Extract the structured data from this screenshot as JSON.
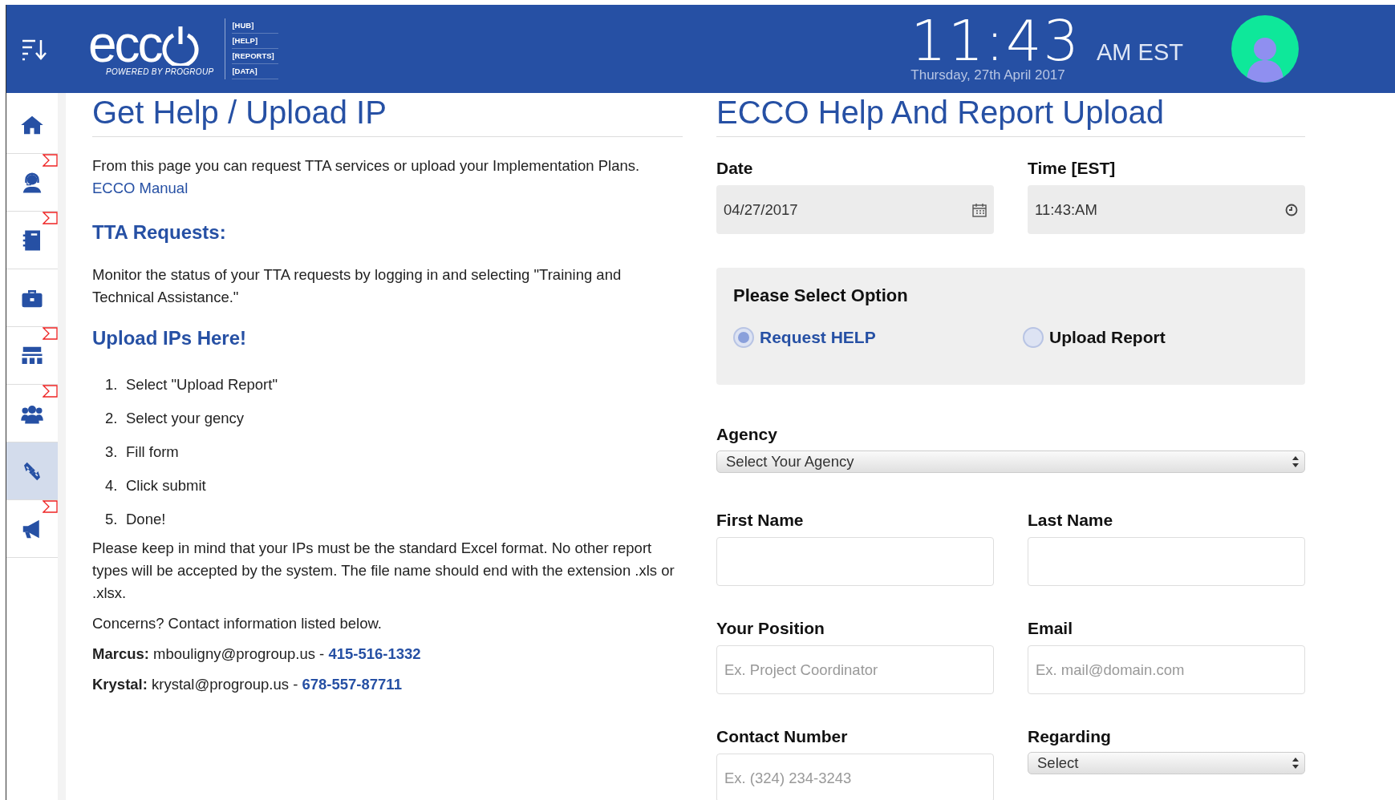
{
  "header": {
    "logo_text": "ecc",
    "logo_tagline": "POWERED BY PROGROUP",
    "logo_links": [
      "[HUB]",
      "[HELP]",
      "[REPORTS]",
      "[DATA]"
    ],
    "time": "11:43",
    "meridiem": "AM EST",
    "date": "Thursday, 27th April 2017"
  },
  "sidebar": {
    "items": [
      {
        "selected": false,
        "flagged": false
      },
      {
        "selected": false,
        "flagged": true
      },
      {
        "selected": false,
        "flagged": true
      },
      {
        "selected": false,
        "flagged": false
      },
      {
        "selected": false,
        "flagged": true
      },
      {
        "selected": false,
        "flagged": true
      },
      {
        "selected": true,
        "flagged": false
      },
      {
        "selected": false,
        "flagged": true
      }
    ]
  },
  "help": {
    "title": "Get Help / Upload IP",
    "intro": "From this page you can request TTA services or upload your Implementation Plans.",
    "manual_link": "ECCO Manual",
    "tta_heading": "TTA Requests:",
    "tta_text": "Monitor the status of your TTA requests by logging in and selecting \"Training and Technical Assistance.\"",
    "upload_heading": "Upload IPs Here!",
    "steps": [
      {
        "number": "1.",
        "text": "Select \"Upload Report\""
      },
      {
        "number": "2.",
        "text": "Select your gency"
      },
      {
        "number": "3.",
        "text": "Fill form"
      },
      {
        "number": "4.",
        "text": "Click submit"
      },
      {
        "number": "5.",
        "text": "Done!"
      }
    ],
    "note": "Please keep in mind that your IPs must be the standard Excel format. No other report types will be accepted by the system. The file name should end with the extension .xls or .xlsx.",
    "concerns": "Concerns? Contact information listed below.",
    "contacts": [
      {
        "text": "**Marcus:** mbouligny@progroup.us - ",
        "phone": "415-516-1332"
      },
      {
        "text": "**Krystal:** krystal@progroup.us - ",
        "phone": "678-557-87711"
      }
    ]
  },
  "form": {
    "title": "ECCO Help And Report Upload",
    "date_label": "Date",
    "date_value": "04/27/2017",
    "time_label": "Time [EST]",
    "time_value": "11:43:AM",
    "option_title": "Please Select Option",
    "options": [
      {
        "label": "Request HELP",
        "selected": true
      },
      {
        "label": "Upload Report",
        "selected": false
      }
    ],
    "agency_label": "Agency",
    "agency_value": "Select Your Agency",
    "fields": [
      {
        "label": "First Name"
      },
      {
        "label": "Last Name"
      },
      {
        "label": "Your Position",
        "placeholder": "Ex. Project Coordinator"
      },
      {
        "label": "Email",
        "placeholder": "Ex. mail@domain.com"
      }
    ],
    "contact_label": "Contact Number",
    "contact_placeholder": "Ex. (324) 234-3243",
    "regarding_label": "Regarding",
    "regarding_value": "Select"
  }
}
